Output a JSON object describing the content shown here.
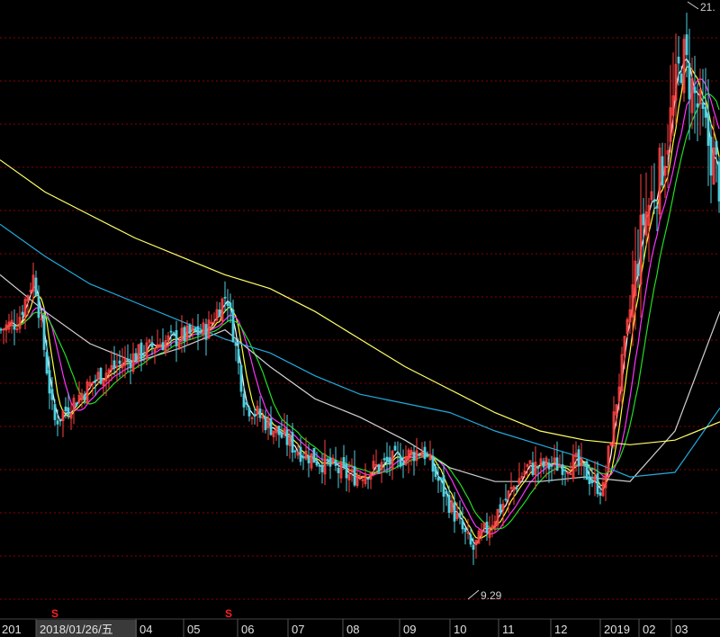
{
  "chart_data": {
    "type": "candlestick",
    "grid": true,
    "background": "#000000",
    "colors": {
      "up": "#ff4040",
      "down": "#4fd0e0",
      "grid": "#8b0000",
      "ma5": "#ffffff",
      "ma10": "#ffff33",
      "ma20": "#ff33ff",
      "ma30": "#22dd22",
      "ma60": "#d0d0d0",
      "ma120": "#22aadd",
      "ma250": "#ffff66",
      "signal": "#ff2020"
    },
    "y_range_estimated": [
      8.5,
      21.5
    ],
    "x_axis_labels": [
      {
        "text": "201",
        "boxed": false
      },
      {
        "text": "2018/01/26/五",
        "boxed": true
      },
      {
        "text": "04",
        "boxed": false
      },
      {
        "text": "05",
        "boxed": false
      },
      {
        "text": "06",
        "boxed": false
      },
      {
        "text": "07",
        "boxed": false
      },
      {
        "text": "08",
        "boxed": false
      },
      {
        "text": "09",
        "boxed": false
      },
      {
        "text": "10",
        "boxed": false
      },
      {
        "text": "11",
        "boxed": false
      },
      {
        "text": "12",
        "boxed": false
      },
      {
        "text": "2019",
        "boxed": false
      },
      {
        "text": "02",
        "boxed": false
      },
      {
        "text": "03",
        "boxed": false
      }
    ],
    "annotations": [
      {
        "text": "21.",
        "value": 21.3,
        "marker": "high"
      },
      {
        "text": "9.29",
        "value": 9.29,
        "marker": "low"
      }
    ],
    "signals": [
      {
        "text": "S",
        "period": "2018-02"
      },
      {
        "text": "S",
        "period": "2018-05"
      }
    ],
    "price_path_estimated": [
      {
        "period": "2017-12",
        "close": 14.4
      },
      {
        "period": "2018-01",
        "close": 14.6
      },
      {
        "period": "2018-01-peak",
        "close": 15.6
      },
      {
        "period": "2018-02",
        "close": 12.4
      },
      {
        "period": "2018-03",
        "close": 13.4
      },
      {
        "period": "2018-04",
        "close": 14.1
      },
      {
        "period": "2018-05",
        "close": 14.4
      },
      {
        "period": "2018-05-peak",
        "close": 15.2
      },
      {
        "period": "2018-06",
        "close": 12.8
      },
      {
        "period": "2018-07",
        "close": 11.8
      },
      {
        "period": "2018-08",
        "close": 11.2
      },
      {
        "period": "2018-09",
        "close": 11.8
      },
      {
        "period": "2018-10",
        "close": 9.6
      },
      {
        "period": "2018-11",
        "close": 11.4
      },
      {
        "period": "2018-12",
        "close": 11.5
      },
      {
        "period": "2019-01",
        "close": 10.9
      },
      {
        "period": "2019-01-late",
        "close": 16.8
      },
      {
        "period": "2019-02",
        "close": 17.9
      },
      {
        "period": "2019-03",
        "close": 20.4
      },
      {
        "period": "2019-03-late",
        "close": 17.6
      }
    ],
    "moving_averages_estimated": {
      "ma250": [
        18.1,
        17.4,
        16.9,
        16.4,
        16.0,
        15.6,
        15.3,
        14.8,
        14.2,
        13.6,
        13.1,
        12.6,
        12.2,
        12.0,
        11.9,
        12.0,
        12.4
      ],
      "ma120": [
        16.7,
        16.0,
        15.4,
        15.0,
        14.6,
        14.2,
        13.9,
        13.4,
        13.0,
        12.8,
        12.6,
        12.2,
        11.9,
        11.6,
        11.2,
        11.3,
        12.7
      ],
      "ma60": [
        15.6,
        14.8,
        14.1,
        13.7,
        14.0,
        14.4,
        13.6,
        12.9,
        12.5,
        12.0,
        11.4,
        11.1,
        11.1,
        11.2,
        11.1,
        12.2,
        14.8
      ]
    }
  }
}
